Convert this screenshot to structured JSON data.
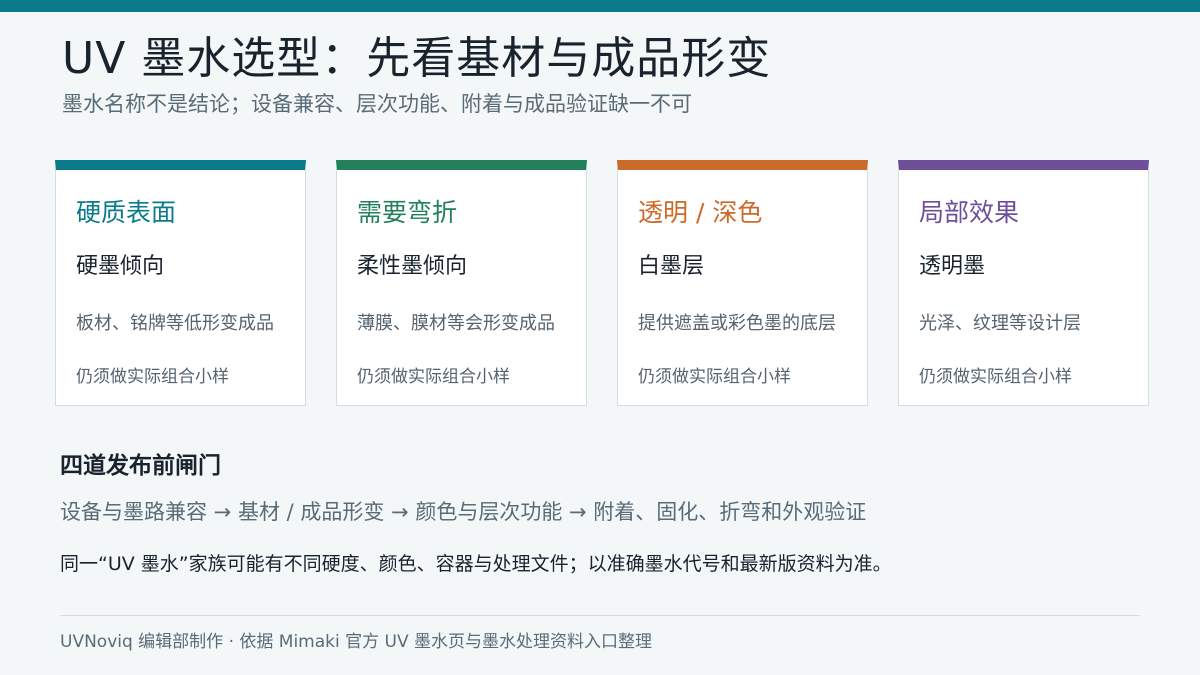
{
  "page": {
    "title": "UV 墨水选型：先看基材与成品形变",
    "subtitle": "墨水名称不是结论；设备兼容、层次功能、附着与成品验证缺一不可"
  },
  "colors": {
    "accent_teal": "#0b7b8b",
    "accent_green": "#22805a",
    "accent_orange": "#cc6a2a",
    "accent_purple": "#6f4f9a"
  },
  "cards": [
    {
      "title": "硬质表面",
      "heading": "硬墨倾向",
      "description": "板材、铭牌等低形变成品",
      "note": "仍须做实际组合小样",
      "color": "#0b7b8b"
    },
    {
      "title": "需要弯折",
      "heading": "柔性墨倾向",
      "description": "薄膜、膜材等会形变成品",
      "note": "仍须做实际组合小样",
      "color": "#22805a"
    },
    {
      "title": "透明 / 深色",
      "heading": "白墨层",
      "description": "提供遮盖或彩色墨的底层",
      "note": "仍须做实际组合小样",
      "color": "#cc6a2a"
    },
    {
      "title": "局部效果",
      "heading": "透明墨",
      "description": "光泽、纹理等设计层",
      "note": "仍须做实际组合小样",
      "color": "#6f4f9a"
    }
  ],
  "gates": {
    "title": "四道发布前闸门",
    "flow": "设备与墨路兼容 → 基材 / 成品形变 → 颜色与层次功能 → 附着、固化、折弯和外观验证",
    "note": "同一“UV 墨水”家族可能有不同硬度、颜色、容器与处理文件；以准确墨水代号和最新版资料为准。"
  },
  "footer": {
    "text": "UVNoviq 编辑部制作 · 依据 Mimaki 官方 UV 墨水页与墨水处理资料入口整理"
  }
}
